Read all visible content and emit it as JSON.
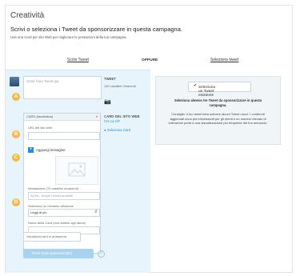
{
  "header": {
    "title": "Creatività",
    "subtitle": "Scrivi o seleziona i Tweet da sponsorizzare in questa campagna.",
    "helper": "Usa una Card per sito Web per migliorare le prestazioni della tua campagna."
  },
  "tabs": {
    "write": "Scrivi Tweet",
    "or": "OPPURE",
    "select": "Seleziona tweet"
  },
  "compose": {
    "placeholder": "Scrivi il tuo Tweet qui",
    "tweet_label": "TWEET",
    "chars_remaining": "140 caratteri rimanenti",
    "badges": [
      "A",
      "B",
      "C",
      "D"
    ]
  },
  "card": {
    "dropdown": "CARD (facoltativa)",
    "side_title": "CARD DEL SITO WEB",
    "side_link": "Cre ca rd?",
    "side_select": "Seleziona Card",
    "url_label": "URL del sito web",
    "add_image": "Aggiungi immagine",
    "headline_label": "Intestazione (70 caratteri rimanenti)",
    "headline_placeholder": "Ad es., Scopri i nostri prodotti!",
    "cta_label": "Seleziona un richiamo all'azione",
    "cta_value": "Leggi di più",
    "name_label": "Nome della Card (non visibile agli utenti)",
    "preview_button": "Visualizza card in anteprima"
  },
  "actions": {
    "submit": "Tweet (solo sponsorizzato)"
  },
  "right_panel": {
    "button": "Seleziona un Tweet esistente",
    "message_bold": "Seleziona almeno tre Tweet da sponsorizzare in questa campagna.",
    "message_tip": "Consiglio: Il tuo tweet idea scrivere alcuni Tweet nuovi. I contenuti aggiornati sono più interessanti per gli utenti e un numero elevato di interazioni porta a una visualizzazione più frequente del tuo annuncio."
  },
  "colors": {
    "accent": "#2b8ad6",
    "badge": "#f3b94a",
    "panel": "#e7f4fb",
    "submit": "#a9d2ef"
  }
}
